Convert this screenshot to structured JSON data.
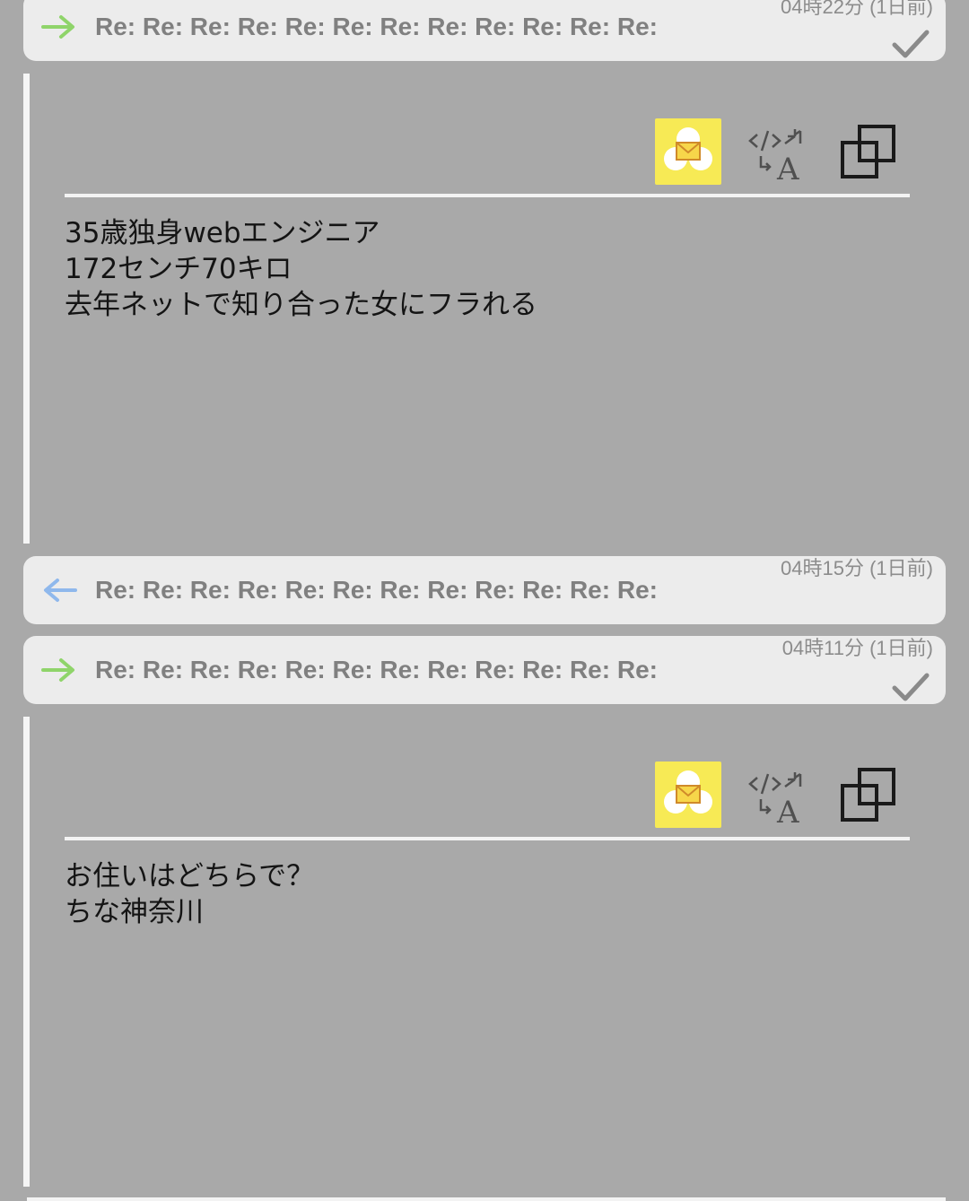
{
  "threads": [
    {
      "direction": "outgoing",
      "direction_icon": "arrow-right-icon",
      "subject": "Re: Re: Re: Re: Re: Re: Re: Re: Re: Re: Re: Re: Re",
      "time": "04時22分 (1日前)",
      "read_icon": "checkmark-icon"
    },
    {
      "direction": "incoming",
      "direction_icon": "arrow-left-icon",
      "subject": "Re: Re: Re: Re: Re: Re: Re: Re: Re: Re: Re: Re: Re",
      "time": "04時15分 (1日前)"
    },
    {
      "direction": "outgoing",
      "direction_icon": "arrow-right-icon",
      "subject": "Re: Re: Re: Re: Re: Re: Re: Re: Re: Re: Re: Re: Re",
      "time": "04時11分 (1日前)",
      "read_icon": "checkmark-icon"
    }
  ],
  "messages": [
    {
      "toolbar_icons": [
        "mail-app-icon",
        "html-translate-icon",
        "copy-icon"
      ],
      "body": "35歳独身webエンジニア\n172センチ70キロ\n去年ネットで知り合った女にフラれる"
    },
    {
      "toolbar_icons": [
        "mail-app-icon",
        "html-translate-icon",
        "copy-icon"
      ],
      "body": "お住いはどちらで？\nちな神奈川"
    }
  ],
  "colors": {
    "background": "#a9a9a9",
    "header_bg": "#ececec",
    "outgoing_arrow": "#8fd46a",
    "incoming_arrow": "#8fb8ec",
    "mail_icon_bg": "#f7ea55",
    "subject_text": "#808080"
  }
}
